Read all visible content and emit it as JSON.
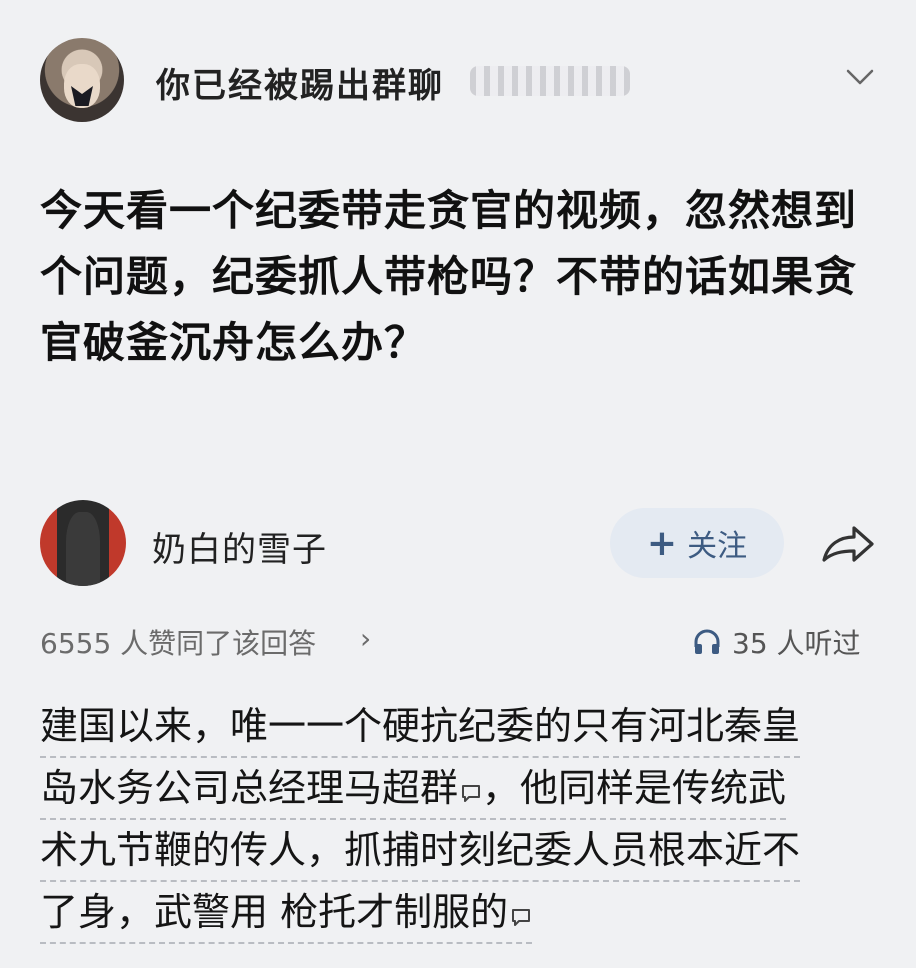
{
  "header": {
    "group_title": "你已经被踢出群聊"
  },
  "question": {
    "text": "今天看一个纪委带走贪官的视频，忽然想到个问题，纪委抓人带枪吗？不带的话如果贪官破釜沉舟怎么办？"
  },
  "author": {
    "name": "奶白的雪子",
    "follow_label": "关注",
    "follow_plus": "+"
  },
  "stats": {
    "likes_text": "6555 人赞同了该回答",
    "likes_chevron": "›",
    "listen_text": "35 人听过"
  },
  "answer": {
    "lines": [
      "建国以来，唯一一个硬抗纪委的只有河北秦皇",
      "岛水务公司总经理马超群",
      "，他同样是传统武",
      "术九节鞭的传人，抓捕时刻纪委人员根本近不",
      "了身，武警用 枪托才制服的"
    ]
  },
  "icons": {
    "chevron": "chevron-down-icon",
    "share": "share-icon",
    "headphone": "headphone-icon",
    "comment": "comment-bubble-icon"
  },
  "colors": {
    "follow_bg": "#e4eaf2",
    "follow_text": "#3d5b82",
    "muted_text": "#6b6b6b"
  }
}
